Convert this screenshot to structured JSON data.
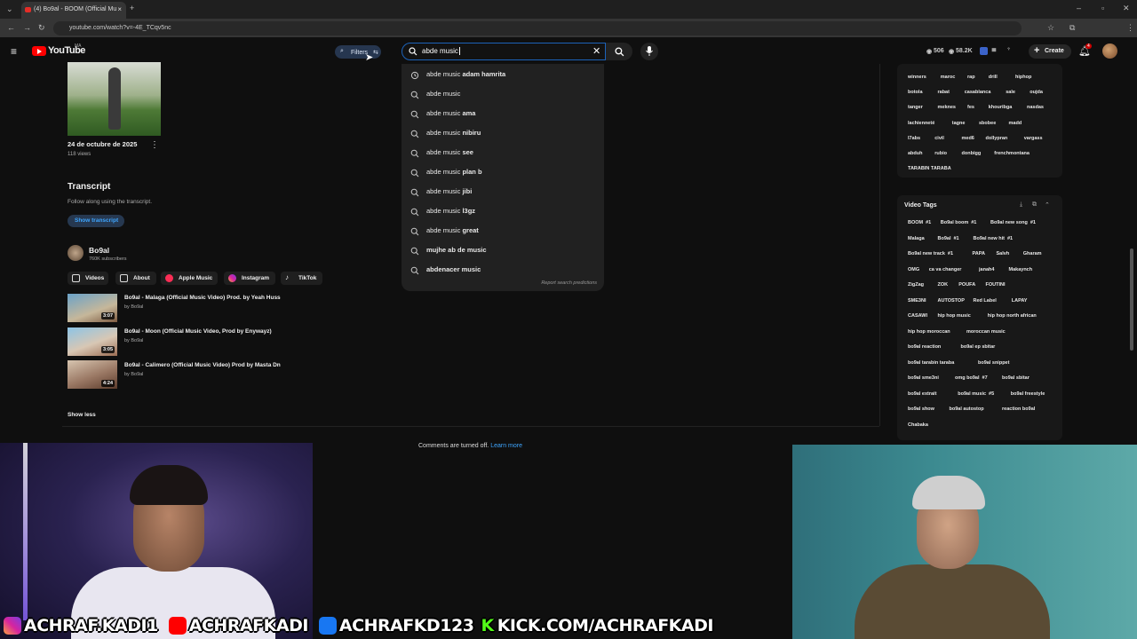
{
  "browser": {
    "tab_title": "(4) Bo9al - BOOM (Official Mu",
    "url": "youtube.com/watch?v=-4E_TCqv5nc"
  },
  "header": {
    "logo_text": "YouTube",
    "logo_region": "MA",
    "filters_label": "Filters",
    "search_value": "abde music",
    "counter_views": "506",
    "counter_subs": "58.2K",
    "create_label": "Create",
    "notifications_count": "4"
  },
  "video": {
    "date": "24 de octubre de 2025",
    "views": "118 views"
  },
  "transcript": {
    "heading": "Transcript",
    "subtitle": "Follow along using the transcript.",
    "button": "Show transcript"
  },
  "channel": {
    "name": "Bo9al",
    "subscribers": "760K subscribers",
    "links": [
      "Videos",
      "About",
      "Apple Music",
      "Instagram",
      "TikTok"
    ]
  },
  "related_videos": [
    {
      "title": "Bo9al - Malaga (Official Music Video) Prod. by Yeah Huss",
      "by": "by Bo9al",
      "duration": "3:07"
    },
    {
      "title": "Bo9al - Moon (Official Music Video, Prod by Enywayz)",
      "by": "by Bo9al",
      "duration": "3:05"
    },
    {
      "title": "Bo9al - Calimero (Official Music Video) Prod by Masta Dn",
      "by": "by Bo9al",
      "duration": "4:24"
    }
  ],
  "show_less": "Show less",
  "suggestions": [
    {
      "typed": "abde music",
      "rest": " adam hamrita",
      "history": true
    },
    {
      "typed": "abde music",
      "rest": "",
      "history": false
    },
    {
      "typed": "abde music",
      "rest": " ama",
      "history": false
    },
    {
      "typed": "abde music",
      "rest": " nibiru",
      "history": false
    },
    {
      "typed": "abde music",
      "rest": " see",
      "history": false
    },
    {
      "typed": "abde music",
      "rest": " plan b",
      "history": false
    },
    {
      "typed": "abde music",
      "rest": " jibi",
      "history": false
    },
    {
      "typed": "abde music",
      "rest": " l3gz",
      "history": false
    },
    {
      "typed": "abde music",
      "rest": " great",
      "history": false
    },
    {
      "typed": "",
      "rest": "mujhe ab de music",
      "history": false
    },
    {
      "typed": "",
      "rest": "abdenacer music",
      "history": false
    }
  ],
  "report_predictions": "Report search predictions",
  "top_tags": [
    [
      "winners",
      "maroc",
      "rap",
      "drill",
      "hiphop"
    ],
    [
      "botola",
      "rabat",
      "casablanca",
      "sale",
      "oujda"
    ],
    [
      "tanger",
      "meknes",
      "fes",
      "khouribga",
      "nasdas"
    ],
    [
      "lachienneté",
      "tagne",
      "sbobee",
      "madd"
    ],
    [
      "l7abs",
      "civil",
      "med6",
      "dollypran",
      "vargass"
    ],
    [
      "abduh",
      "rubio",
      "donbigg",
      "frenchmontana"
    ],
    [
      "TARABIN TARABA"
    ]
  ],
  "video_tags": {
    "heading": "Video Tags",
    "rows": [
      [
        [
          "BOOM",
          "#1"
        ],
        [
          "Bo9al boom",
          "#1"
        ],
        [
          "Bo9al new song",
          "#1"
        ]
      ],
      [
        [
          "Malaga",
          ""
        ],
        [
          "Bo9al",
          "#1"
        ],
        [
          "Bo9al new hit",
          "#1"
        ]
      ],
      [
        [
          "Bo9al new track",
          "#1"
        ],
        [
          "PAPA",
          ""
        ],
        [
          "Salvh",
          ""
        ],
        [
          "Gharam",
          ""
        ]
      ],
      [
        [
          "OMG",
          ""
        ],
        [
          "ca va changer",
          ""
        ],
        [
          "janah4",
          ""
        ],
        [
          "Makaynch",
          ""
        ]
      ],
      [
        [
          "ZigZag",
          ""
        ],
        [
          "ZOK",
          ""
        ],
        [
          "POUFA",
          ""
        ],
        [
          "FOUTINI",
          ""
        ]
      ],
      [
        [
          "SME3NI",
          ""
        ],
        [
          "AUTOSTOP",
          ""
        ],
        [
          "Red Label",
          ""
        ],
        [
          "LAPAY",
          ""
        ]
      ],
      [
        [
          "CASAWI",
          ""
        ],
        [
          "hip hop music",
          ""
        ],
        [
          "hip hop north african",
          ""
        ]
      ],
      [
        [
          "hip hop moroccan",
          ""
        ],
        [
          "moroccan music",
          ""
        ]
      ],
      [
        [
          "bo9al reaction",
          ""
        ],
        [
          "bo9al ep sbitar",
          ""
        ]
      ],
      [
        [
          "bo9al tarabin taraba",
          ""
        ],
        [
          "bo9al snippet",
          ""
        ]
      ],
      [
        [
          "bo9al sme3ni",
          ""
        ],
        [
          "omg bo9al",
          "#7"
        ],
        [
          "bo9al sbitar",
          ""
        ]
      ],
      [
        [
          "bo9al extrait",
          ""
        ],
        [
          "bo9al music",
          "#5"
        ],
        [
          "bo9al freestyle",
          ""
        ]
      ],
      [
        [
          "bo9al show",
          ""
        ],
        [
          "bo9al autostop",
          ""
        ],
        [
          "reaction bo9al",
          ""
        ]
      ],
      [
        [
          "Chabaka",
          ""
        ]
      ]
    ]
  },
  "comments": {
    "text": "Comments are turned off.",
    "link": "Learn more"
  },
  "stream_banner": {
    "instagram": "ACHRAF.KADI1",
    "youtube": "ACHRAFKADI",
    "facebook": "ACHRAFKD123",
    "kick": "KICK.COM/ACHRAFKADI"
  },
  "colors": {
    "accent_blue": "#3ea6ff",
    "yt_red": "#ff0000",
    "kick_green": "#53fc18"
  }
}
